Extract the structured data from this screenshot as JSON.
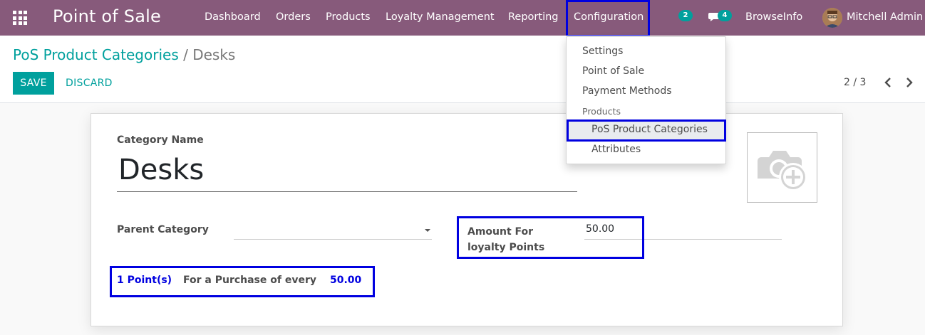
{
  "navbar": {
    "app_title": "Point of Sale",
    "menu": [
      "Dashboard",
      "Orders",
      "Products",
      "Loyalty Management",
      "Reporting",
      "Configuration"
    ],
    "activity_count": "2",
    "message_count": "4",
    "company": "BrowseInfo",
    "user": "Mitchell Admin"
  },
  "breadcrumb": {
    "parent": "PoS Product Categories",
    "separator": "/",
    "current": "Desks"
  },
  "buttons": {
    "save": "SAVE",
    "discard": "DISCARD"
  },
  "pager": {
    "value": "2 / 3"
  },
  "form": {
    "category_name_label": "Category Name",
    "category_name": "Desks",
    "parent_category_label": "Parent Category",
    "parent_category_value": "",
    "amount_label_line1": "Amount For",
    "amount_label_line2": "loyalty Points",
    "amount_value": "50.00",
    "points_text_1": "1 Point(s)",
    "points_text_2": "For a Purchase of every",
    "points_text_3": "50.00"
  },
  "dropdown": {
    "items": [
      "Settings",
      "Point of Sale",
      "Payment Methods"
    ],
    "section_header": "Products",
    "sub_items": [
      "PoS Product Categories",
      "Attributes"
    ]
  },
  "colors": {
    "navbar": "#875a7b",
    "accent": "#00a09d",
    "highlight": "#0000e0"
  },
  "icons": [
    "apps-grid-icon",
    "chat-icon",
    "camera-plus-icon",
    "chevron-left-icon",
    "chevron-right-icon",
    "caret-down-icon"
  ]
}
